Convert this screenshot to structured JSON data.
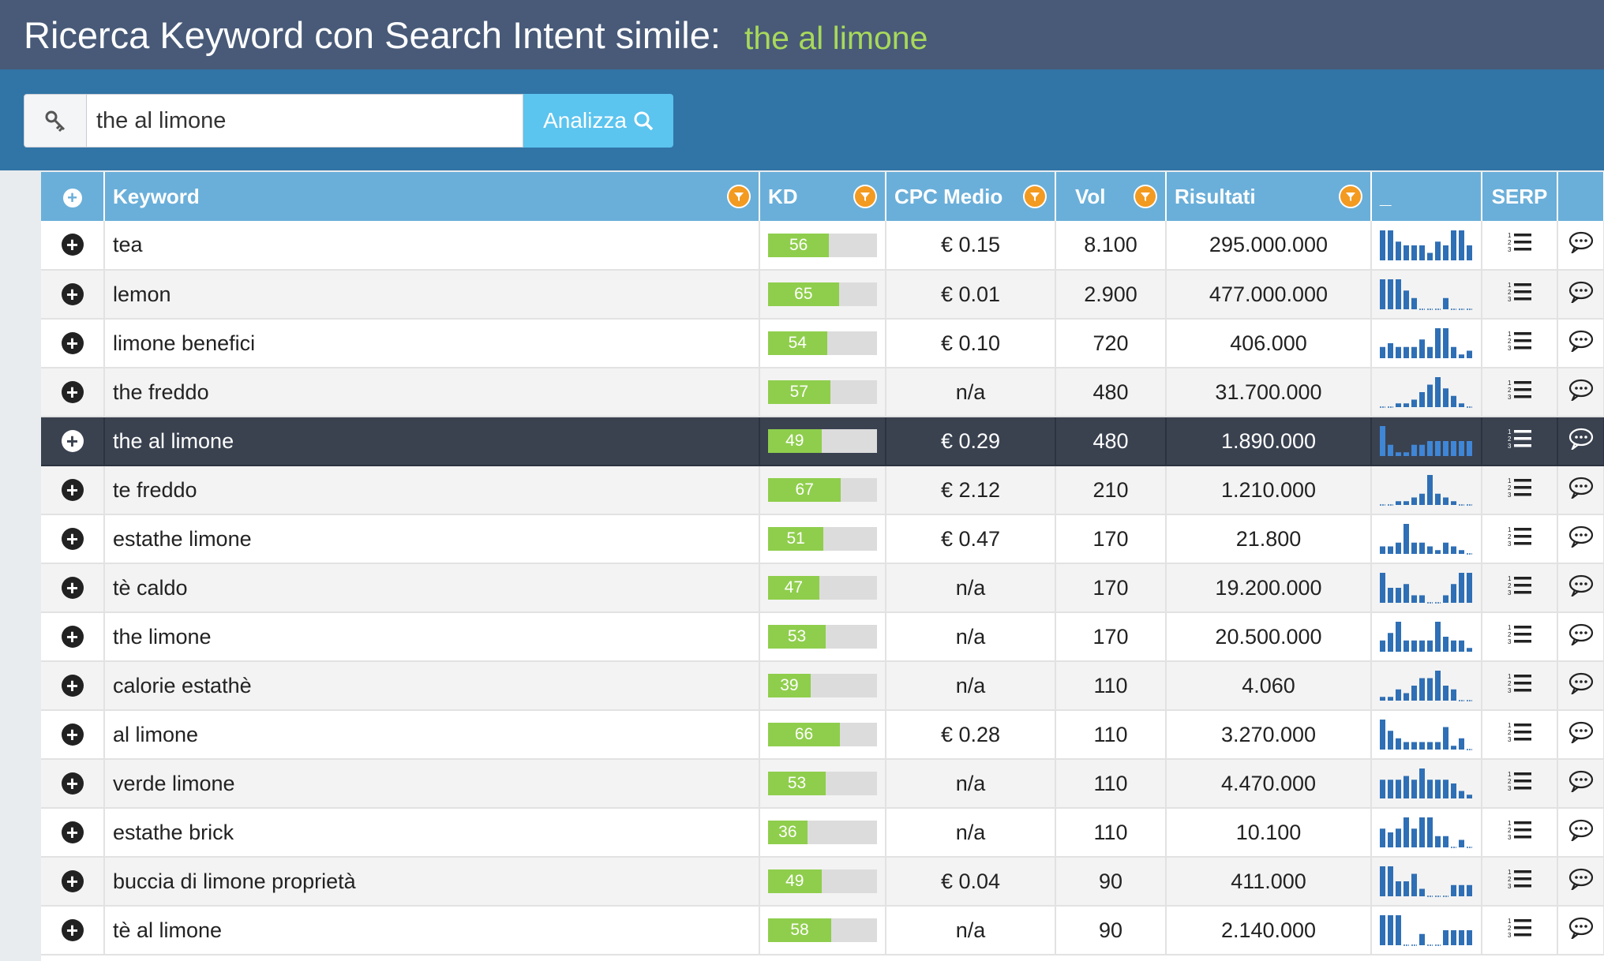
{
  "header": {
    "title": "Ricerca Keyword con Search Intent simile:",
    "keyword": "the al limone"
  },
  "search": {
    "value": "the al limone",
    "button_label": "Analizza"
  },
  "table": {
    "columns": {
      "keyword": "Keyword",
      "kd": "KD",
      "cpc": "CPC Medio",
      "vol": "Vol",
      "results": "Risultati",
      "trend": "_",
      "serp": "SERP"
    },
    "rows": [
      {
        "keyword": "tea",
        "kd": "56",
        "cpc": "€ 0.15",
        "vol": "8.100",
        "results": "295.000.000",
        "trend": [
          8,
          8,
          5,
          4,
          4,
          4,
          2,
          5,
          4,
          8,
          8,
          4
        ]
      },
      {
        "keyword": "lemon",
        "kd": "65",
        "cpc": "€ 0.01",
        "vol": "2.900",
        "results": "477.000.000",
        "trend": [
          8,
          8,
          8,
          5,
          3,
          0,
          0,
          0,
          3,
          0,
          0,
          0
        ]
      },
      {
        "keyword": "limone benefici",
        "kd": "54",
        "cpc": "€ 0.10",
        "vol": "720",
        "results": "406.000",
        "trend": [
          3,
          4,
          3,
          3,
          3,
          5,
          3,
          8,
          8,
          3,
          1,
          2
        ]
      },
      {
        "keyword": "the freddo",
        "kd": "57",
        "cpc": "n/a",
        "vol": "480",
        "results": "31.700.000",
        "trend": [
          0,
          0,
          1,
          1,
          2,
          4,
          6,
          8,
          5,
          3,
          1,
          0
        ]
      },
      {
        "keyword": "the al limone",
        "kd": "49",
        "cpc": "€ 0.29",
        "vol": "480",
        "results": "1.890.000",
        "trend": [
          8,
          3,
          1,
          1,
          3,
          3,
          4,
          4,
          4,
          4,
          4,
          4
        ],
        "selected": true
      },
      {
        "keyword": "te freddo",
        "kd": "67",
        "cpc": "€ 2.12",
        "vol": "210",
        "results": "1.210.000",
        "trend": [
          0,
          0,
          1,
          1,
          2,
          3,
          8,
          3,
          2,
          1,
          0,
          0
        ]
      },
      {
        "keyword": "estathe limone",
        "kd": "51",
        "cpc": "€ 0.47",
        "vol": "170",
        "results": "21.800",
        "trend": [
          2,
          2,
          3,
          8,
          3,
          3,
          2,
          1,
          3,
          2,
          1,
          0
        ]
      },
      {
        "keyword": "tè caldo",
        "kd": "47",
        "cpc": "n/a",
        "vol": "170",
        "results": "19.200.000",
        "trend": [
          8,
          4,
          4,
          5,
          2,
          2,
          0,
          0,
          2,
          5,
          8,
          8
        ]
      },
      {
        "keyword": "the limone",
        "kd": "53",
        "cpc": "n/a",
        "vol": "170",
        "results": "20.500.000",
        "trend": [
          3,
          5,
          8,
          3,
          3,
          3,
          3,
          8,
          4,
          3,
          3,
          1
        ]
      },
      {
        "keyword": "calorie estathè",
        "kd": "39",
        "cpc": "n/a",
        "vol": "110",
        "results": "4.060",
        "trend": [
          1,
          1,
          3,
          2,
          4,
          6,
          6,
          8,
          4,
          3,
          0,
          0
        ]
      },
      {
        "keyword": "al limone",
        "kd": "66",
        "cpc": "€ 0.28",
        "vol": "110",
        "results": "3.270.000",
        "trend": [
          8,
          5,
          3,
          2,
          2,
          2,
          2,
          2,
          6,
          1,
          3,
          0
        ]
      },
      {
        "keyword": "verde limone",
        "kd": "53",
        "cpc": "n/a",
        "vol": "110",
        "results": "4.470.000",
        "trend": [
          5,
          5,
          5,
          6,
          5,
          8,
          5,
          5,
          5,
          4,
          2,
          1
        ]
      },
      {
        "keyword": "estathe brick",
        "kd": "36",
        "cpc": "n/a",
        "vol": "110",
        "results": "10.100",
        "trend": [
          5,
          4,
          5,
          8,
          5,
          8,
          8,
          3,
          3,
          0,
          2,
          0
        ]
      },
      {
        "keyword": "buccia di limone proprietà",
        "kd": "49",
        "cpc": "€ 0.04",
        "vol": "90",
        "results": "411.000",
        "trend": [
          8,
          8,
          4,
          4,
          6,
          2,
          0,
          0,
          0,
          3,
          3,
          3
        ]
      },
      {
        "keyword": "tè al limone",
        "kd": "58",
        "cpc": "n/a",
        "vol": "90",
        "results": "2.140.000",
        "trend": [
          8,
          8,
          8,
          0,
          0,
          3,
          0,
          0,
          4,
          4,
          4,
          4
        ]
      }
    ]
  },
  "colors": {
    "header_bg": "#485a78",
    "accent_green": "#a8d95b",
    "searchbar_bg": "#3174a6",
    "table_header_bg": "#6aafd9",
    "filter_orange": "#f39a21",
    "kd_green": "#8fce4c",
    "trend_blue": "#2f6fb5",
    "selected_row": "#3a4250"
  }
}
